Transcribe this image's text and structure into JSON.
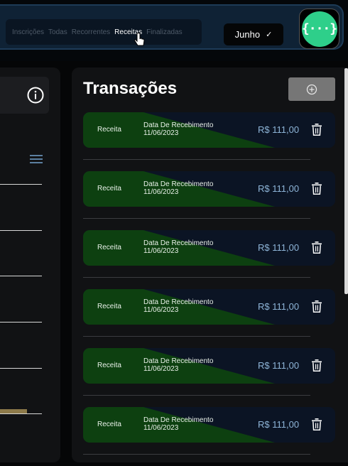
{
  "header": {
    "filters": [
      "Inscrições",
      "Todas",
      "Recorrentes",
      "Receitas",
      "Finalizadas"
    ],
    "active_filter": "Receitas",
    "month": "Junho",
    "logo_text": "{···}"
  },
  "transactions_panel": {
    "title": "Transações",
    "items": [
      {
        "type": "Receita",
        "date_label": "Data De Recebimento",
        "date": "11/06/2023",
        "amount": "R$ 111,00"
      },
      {
        "type": "Receita",
        "date_label": "Data De Recebimento",
        "date": "11/06/2023",
        "amount": "R$ 111,00"
      },
      {
        "type": "Receita",
        "date_label": "Data De Recebimento",
        "date": "11/06/2023",
        "amount": "R$ 111,00"
      },
      {
        "type": "Receita",
        "date_label": "Data De Recebimento",
        "date": "11/06/2023",
        "amount": "R$ 111,00"
      },
      {
        "type": "Receita",
        "date_label": "Data De Recebimento",
        "date": "11/06/2023",
        "amount": "R$ 111,00"
      },
      {
        "type": "Receita",
        "date_label": "Data De Recebimento",
        "date": "11/06/2023",
        "amount": "R$ 111,00"
      }
    ]
  },
  "icons": [
    "info-icon",
    "menu-icon",
    "plus-circle-icon",
    "trash-icon",
    "check-icon",
    "pointer-cursor-icon"
  ],
  "colors": {
    "income_green": "#0d4010",
    "card_bg": "#0b1424",
    "amount_blue": "#8eb5d8",
    "logo_green": "#2ecf8a"
  }
}
